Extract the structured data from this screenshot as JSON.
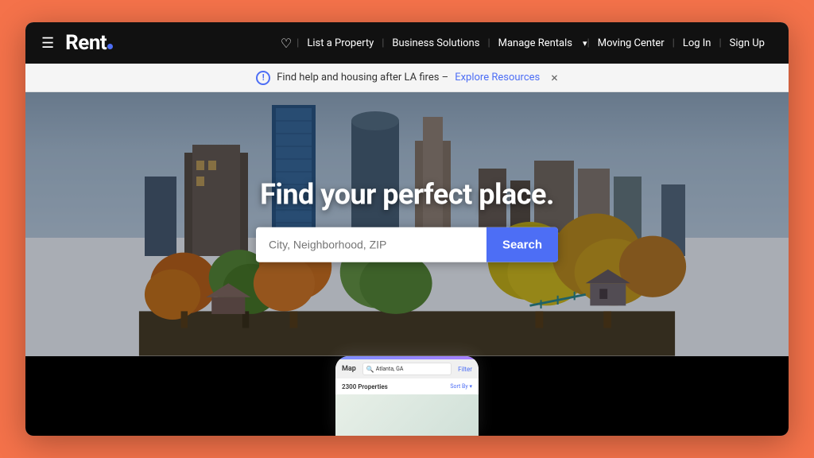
{
  "app": {
    "title": "Rent."
  },
  "navbar": {
    "hamburger_label": "☰",
    "heart_label": "♡",
    "separator": "|",
    "list_property": "List a Property",
    "business_solutions": "Business Solutions",
    "manage_rentals": "Manage Rentals",
    "manage_rentals_arrow": "▾",
    "moving_center": "Moving Center",
    "log_in": "Log In",
    "sign_up": "Sign Up"
  },
  "announcement": {
    "icon": "!",
    "text": "Find help and housing after LA fires –",
    "link_text": "Explore Resources",
    "close": "×"
  },
  "hero": {
    "title": "Find your perfect place.",
    "search_placeholder": "City, Neighborhood, ZIP",
    "search_button": "Search"
  },
  "phone": {
    "tab_map": "Map",
    "search_location": "Atlanta, GA",
    "filter_label": "Filter",
    "property_count": "2300 Properties",
    "sort_label": "Sort By ▾"
  }
}
